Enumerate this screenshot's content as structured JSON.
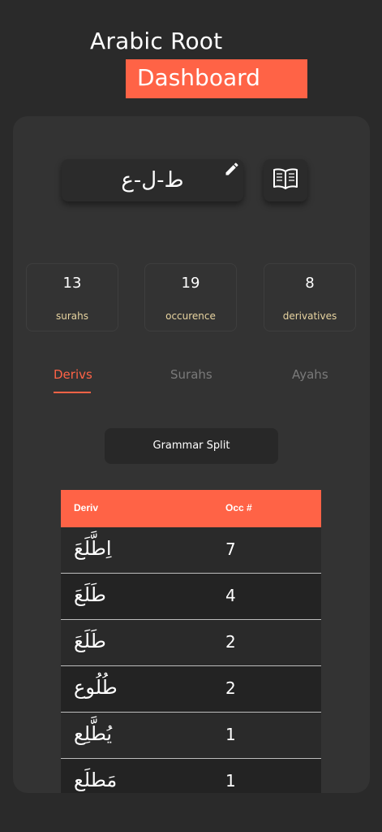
{
  "header": {
    "title_line1": "Arabic Root",
    "title_line2": "Dashboard"
  },
  "root": {
    "text": "ط-ل-ع",
    "edit_icon": "pencil-icon",
    "book_icon": "open-book-icon"
  },
  "stats": [
    {
      "value": "13",
      "label": "surahs"
    },
    {
      "value": "19",
      "label": "occurence"
    },
    {
      "value": "8",
      "label": "derivatives"
    }
  ],
  "tabs": [
    {
      "label": "Derivs",
      "active": true
    },
    {
      "label": "Surahs",
      "active": false
    },
    {
      "label": "Ayahs",
      "active": false
    }
  ],
  "grammar_button": "Grammar Split",
  "table": {
    "headers": [
      "Deriv",
      "Occ #"
    ],
    "rows": [
      {
        "deriv": "اِطَّلَعَ",
        "occ": "7"
      },
      {
        "deriv": "طَلَعَ",
        "occ": "4"
      },
      {
        "deriv": "طَلَعَ",
        "occ": "2"
      },
      {
        "deriv": "طُلُوع",
        "occ": "2"
      },
      {
        "deriv": "يُطَّلِع",
        "occ": "1"
      },
      {
        "deriv": "مَطلَع",
        "occ": "1"
      }
    ]
  },
  "colors": {
    "accent": "#ff6346",
    "background": "#2a2a2a",
    "card": "#333333",
    "stat_label": "#e8d4a0"
  }
}
